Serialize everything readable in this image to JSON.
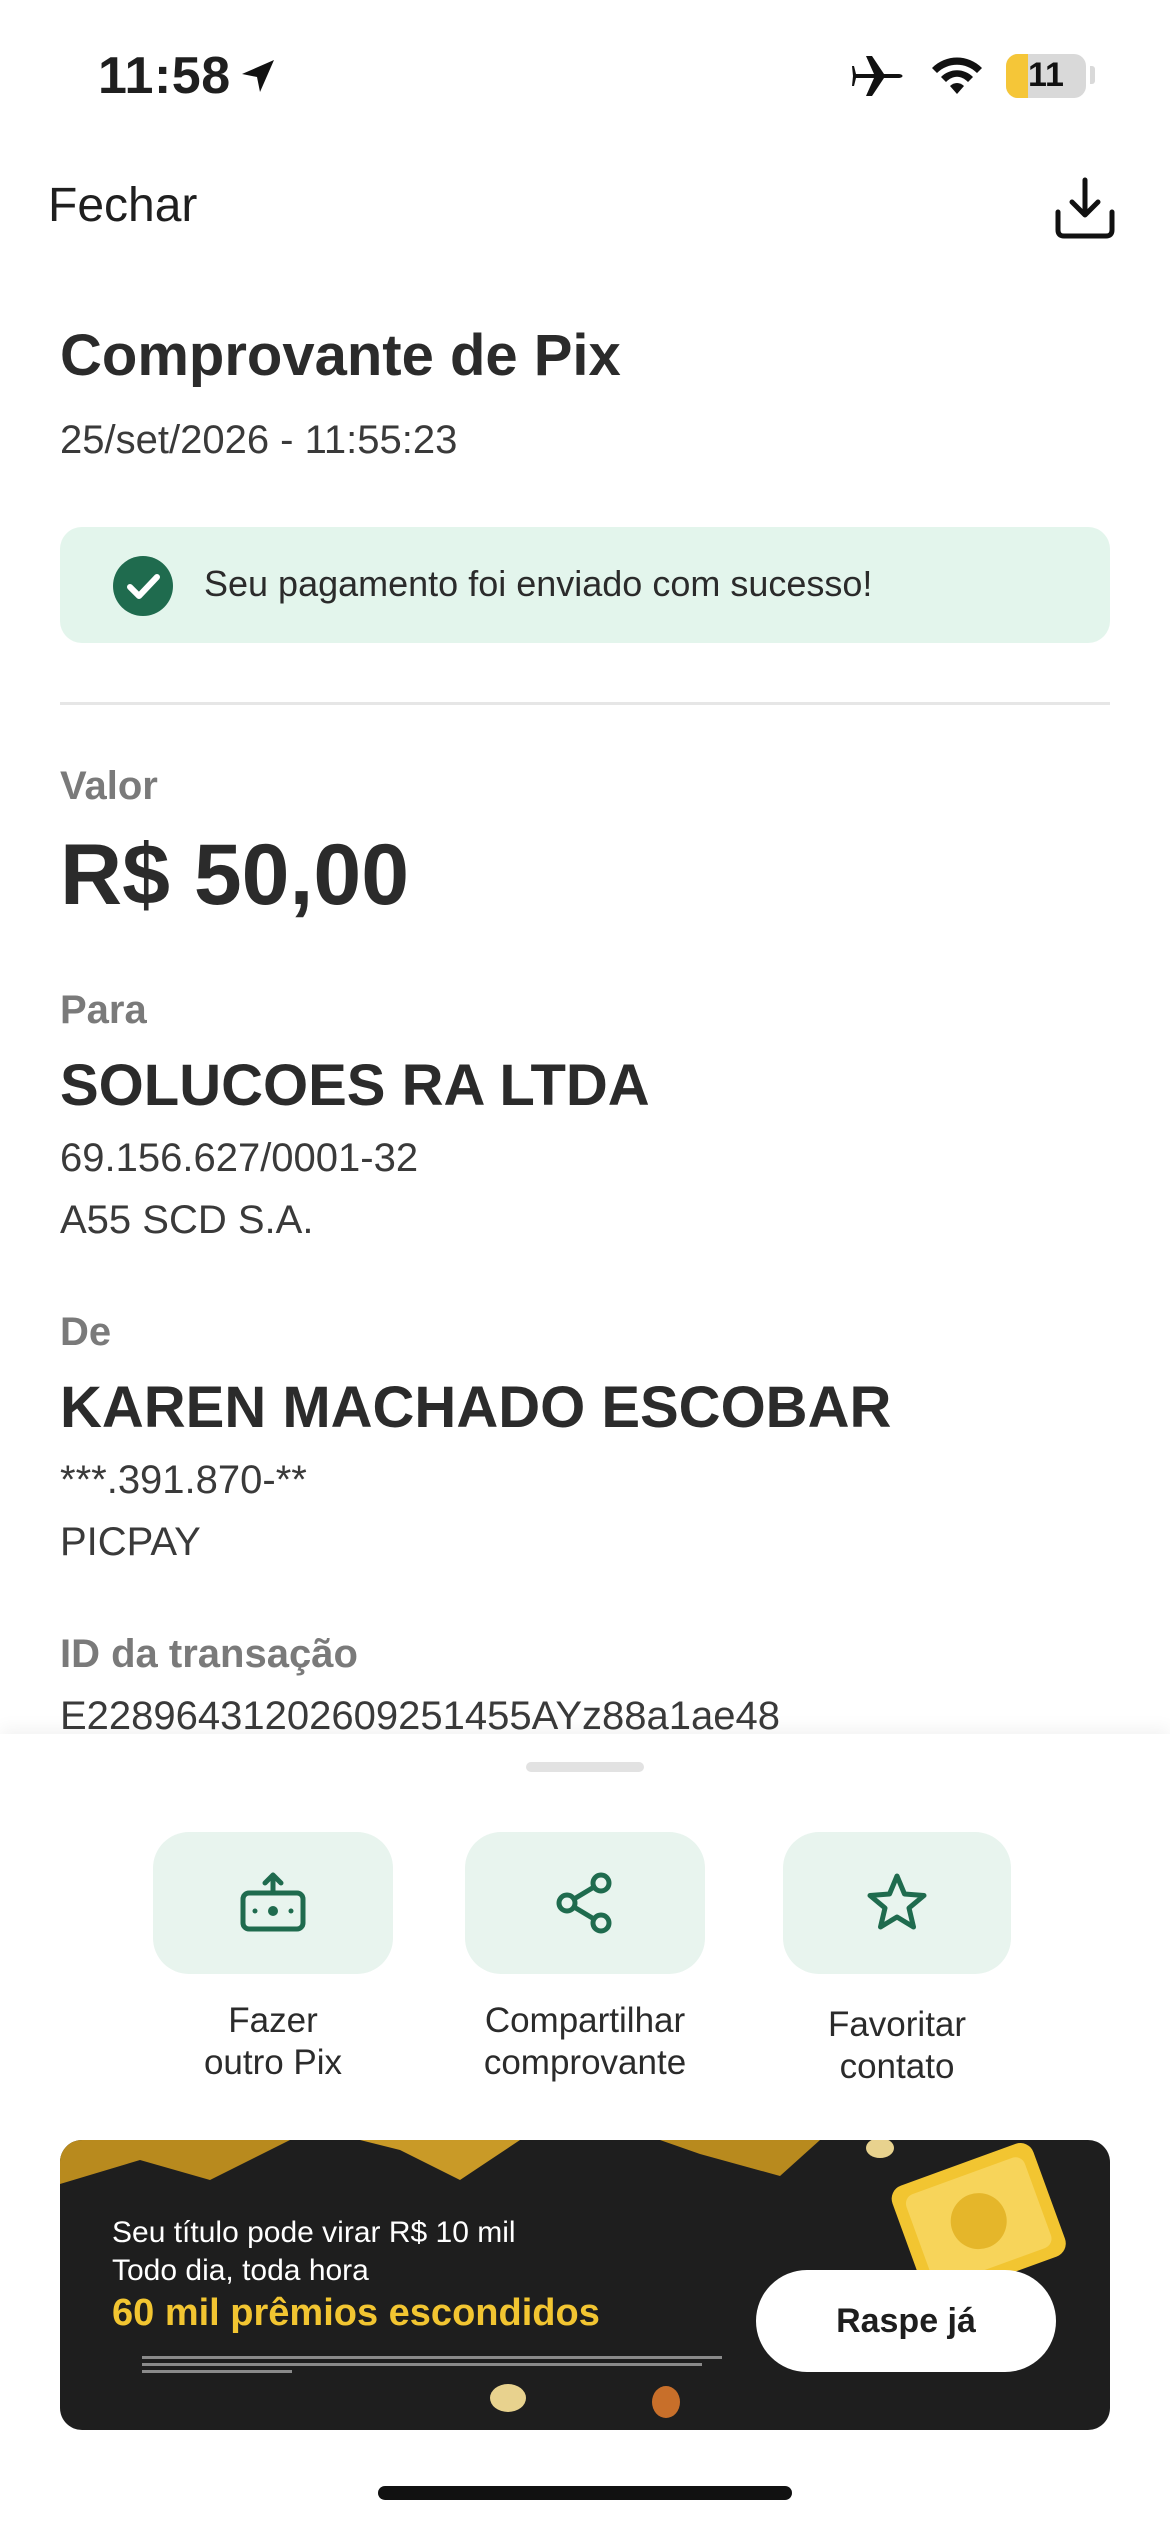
{
  "status_bar": {
    "time": "11:58",
    "battery": "11",
    "icons": [
      "location-arrow-icon",
      "airplane-icon",
      "wifi-icon",
      "battery-icon"
    ]
  },
  "header": {
    "close_label": "Fechar",
    "download_icon": "download-icon"
  },
  "receipt": {
    "title": "Comprovante de Pix",
    "datetime": "25/set/2026 - 11:55:23",
    "success_message": "Seu pagamento foi enviado com sucesso!",
    "value_label": "Valor",
    "value": "R$ 50,00",
    "to": {
      "label": "Para",
      "name": "SOLUCOES RA LTDA",
      "document": "69.156.627/0001-32",
      "institution": "A55 SCD S.A."
    },
    "from": {
      "label": "De",
      "name": "KAREN MACHADO ESCOBAR",
      "document": "***.391.870-**",
      "institution": "PICPAY"
    },
    "transaction": {
      "label": "ID da transação",
      "id": "E22896431202609251455AYz88a1ae48"
    }
  },
  "actions": [
    {
      "label": "Fazer\noutro Pix",
      "icon": "send-money-icon"
    },
    {
      "label": "Compartilhar\ncomprovante",
      "icon": "share-icon"
    },
    {
      "label": "Favoritar\ncontato",
      "icon": "star-icon"
    }
  ],
  "banner": {
    "line1": "Seu título pode virar R$ 10 mil",
    "line2": "Todo dia, toda hora",
    "line3": "60 mil prêmios escondidos",
    "cta": "Raspe já"
  },
  "colors": {
    "accent": "#1f6b4e",
    "success_bg": "#e3f5ec",
    "action_tile_bg": "#e8f4ee",
    "banner_bg": "#1e1e1e",
    "banner_highlight": "#f2c531"
  }
}
